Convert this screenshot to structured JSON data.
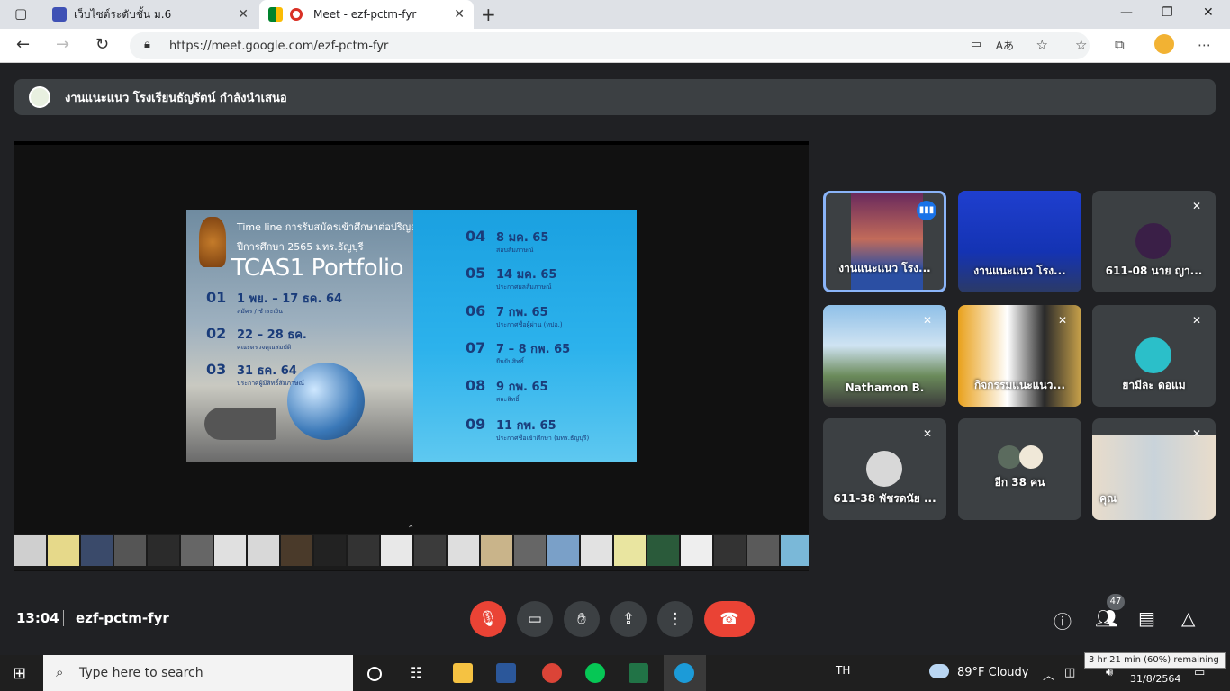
{
  "browser": {
    "tabs": [
      {
        "title": "เว็บไซต์ระดับชั้น ม.6"
      },
      {
        "title": "Meet - ezf-pctm-fyr"
      }
    ],
    "url": "https://meet.google.com/ezf-pctm-fyr"
  },
  "meet": {
    "presenter_banner": "งานแนะแนว โรงเรียนธัญรัตน์ กำลังนำเสนอ",
    "slide": {
      "title_line1": "Time line การรับสมัครเข้าศึกษาต่อปริญญาตรี",
      "title_line2": "ปีการศึกษา 2565 มทร.ธัญบุรี",
      "heading": "TCAS1 Portfolio",
      "steps": [
        {
          "num": "01",
          "date": "1 พย. – 17 ธค. 64",
          "desc": "สมัคร / ชำระเงิน"
        },
        {
          "num": "02",
          "date": "22 – 28 ธค.",
          "desc": "คณะตรวจคุณสมบัติ"
        },
        {
          "num": "03",
          "date": "31 ธค. 64",
          "desc": "ประกาศผู้มีสิทธิ์สัมภาษณ์"
        },
        {
          "num": "04",
          "date": "8 มค. 65",
          "desc": "สอบสัมภาษณ์"
        },
        {
          "num": "05",
          "date": "14 มค. 65",
          "desc": "ประกาศผลสัมภาษณ์"
        },
        {
          "num": "06",
          "date": "7 กพ. 65",
          "desc": "ประกาศชื่อผู้ผ่าน (ทปอ.)"
        },
        {
          "num": "07",
          "date": "7 – 8 กพ. 65",
          "desc": "ยืนยันสิทธิ์"
        },
        {
          "num": "08",
          "date": "9 กพ. 65",
          "desc": "สละสิทธิ์"
        },
        {
          "num": "09",
          "date": "11 กพ. 65",
          "desc": "ประกาศชื่อเข้าศึกษา (มทร.ธัญบุรี)"
        }
      ]
    },
    "participants": [
      {
        "name": "งานแนะแนว โรง...",
        "status": "speaking"
      },
      {
        "name": "งานแนะแนว โรง...",
        "status": "video"
      },
      {
        "name": "611-08 นาย ญา...",
        "status": "muted"
      },
      {
        "name": "Nathamon B.",
        "status": "muted"
      },
      {
        "name": "กิจกรรมแนะแนว...",
        "status": "muted"
      },
      {
        "name": "ยามีละ ดอแม",
        "status": "muted"
      },
      {
        "name": "611-38 พัชรดนัย ...",
        "status": "muted"
      },
      {
        "name": "อีก 38 คน",
        "status": "others"
      },
      {
        "name": "คุณ",
        "status": "muted"
      }
    ],
    "time": "13:04",
    "meeting_code": "ezf-pctm-fyr",
    "participant_count": "47"
  },
  "taskbar": {
    "search_placeholder": "Type here to search",
    "language": "TH",
    "weather": "89°F  Cloudy",
    "date": "31/8/2564",
    "battery_tooltip": "3 hr 21 min (60%) remaining"
  },
  "colors": {
    "meet_bg": "#202124",
    "tile_bg": "#3c4043",
    "end_call": "#ea4335",
    "active_border": "#8ab4f8"
  }
}
